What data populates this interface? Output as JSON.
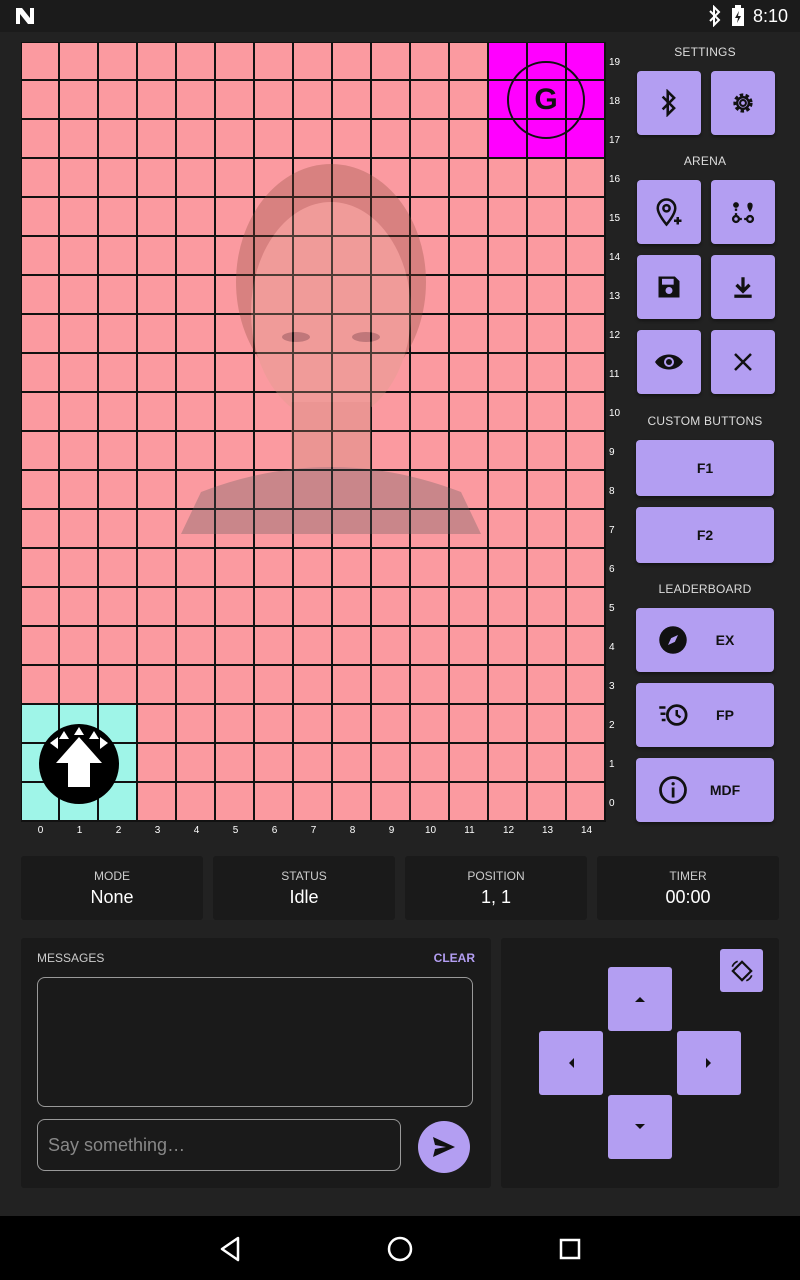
{
  "status_bar": {
    "time": "8:10"
  },
  "grid": {
    "rows": 20,
    "cols": 15,
    "row_labels": [
      "19",
      "18",
      "17",
      "16",
      "15",
      "14",
      "13",
      "12",
      "11",
      "10",
      "9",
      "8",
      "7",
      "6",
      "5",
      "4",
      "3",
      "2",
      "1",
      "0"
    ],
    "col_labels": [
      "0",
      "1",
      "2",
      "3",
      "4",
      "5",
      "6",
      "7",
      "8",
      "9",
      "10",
      "11",
      "12",
      "13",
      "14"
    ],
    "goal_label": "G",
    "colors": {
      "cell": "#fb9aa0",
      "start": "#9ff5e8",
      "goal": "#ff00ff"
    }
  },
  "panel": {
    "settings_title": "SETTINGS",
    "arena_title": "ARENA",
    "custom_title": "CUSTOM BUTTONS",
    "f1": "F1",
    "f2": "F2",
    "leaderboard_title": "LEADERBOARD",
    "ex": "EX",
    "fp": "FP",
    "mdf": "MDF"
  },
  "info": {
    "mode_label": "MODE",
    "mode_value": "None",
    "status_label": "STATUS",
    "status_value": "Idle",
    "position_label": "POSITION",
    "position_value": "1, 1",
    "timer_label": "TIMER",
    "timer_value": "00:00"
  },
  "messages": {
    "title": "MESSAGES",
    "clear": "CLEAR",
    "placeholder": "Say something…"
  },
  "accent_color": "#b39ef2"
}
